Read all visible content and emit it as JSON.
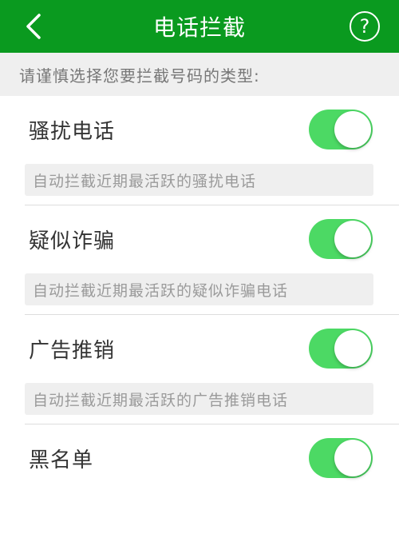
{
  "header": {
    "title": "电话拦截",
    "help_label": "?"
  },
  "hint": "请谨慎选择您要拦截号码的类型:",
  "items": [
    {
      "title": "骚扰电话",
      "desc": "自动拦截近期最活跃的骚扰电话",
      "enabled": true
    },
    {
      "title": "疑似诈骗",
      "desc": "自动拦截近期最活跃的疑似诈骗电话",
      "enabled": true
    },
    {
      "title": "广告推销",
      "desc": "自动拦截近期最活跃的广告推销电话",
      "enabled": true
    },
    {
      "title": "黑名单",
      "desc": "",
      "enabled": true
    }
  ],
  "colors": {
    "header": "#0a9a1f",
    "toggle_on": "#4cd964"
  }
}
